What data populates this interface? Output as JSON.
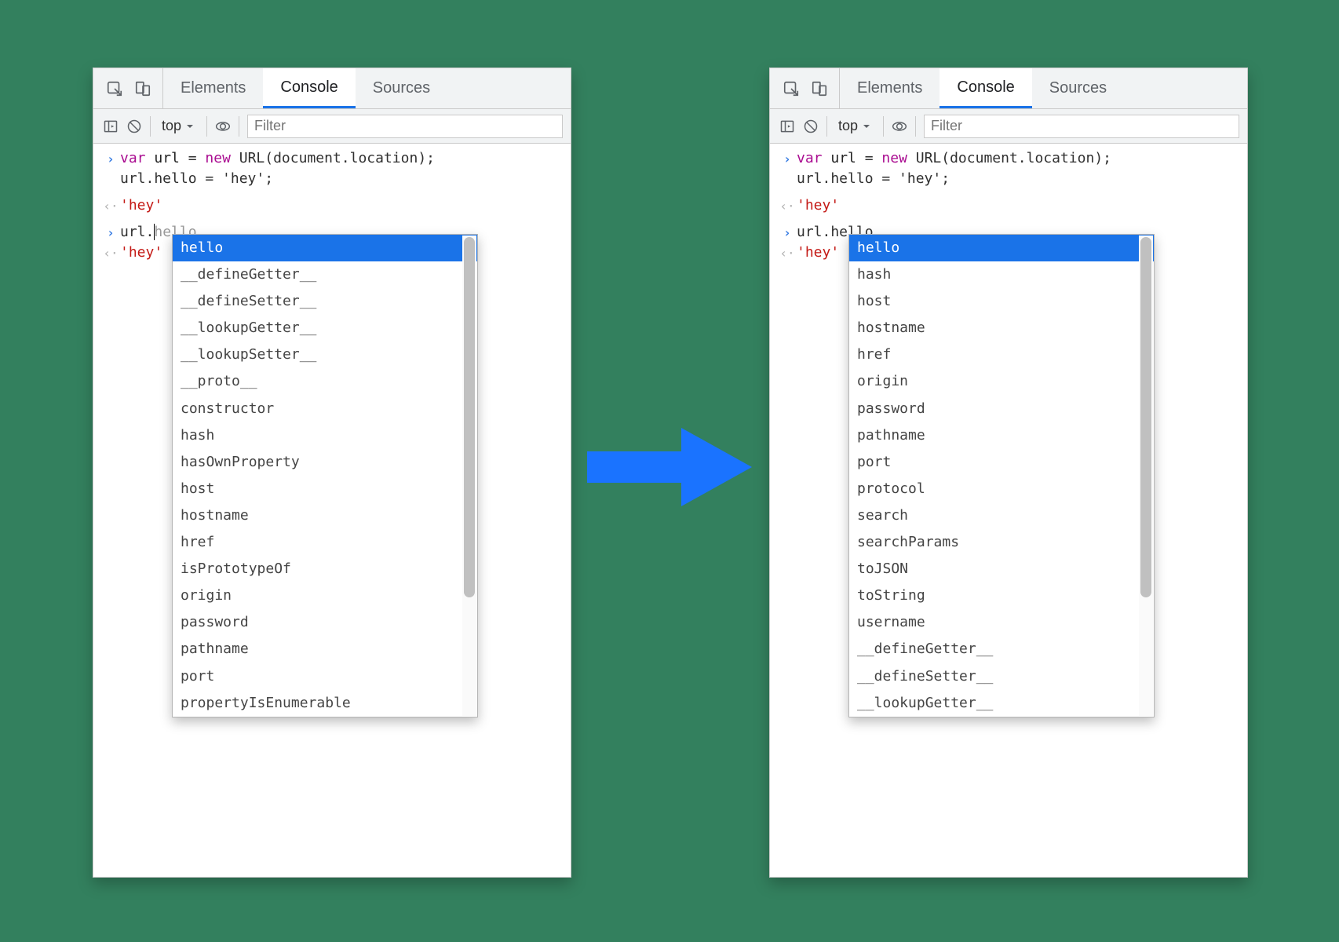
{
  "tabs": {
    "elements": "Elements",
    "console": "Console",
    "sources": "Sources"
  },
  "toolbar": {
    "context": "top",
    "filter_placeholder": "Filter"
  },
  "code": {
    "line1_var": "var",
    "line1_id": "url",
    "line1_eq": " = ",
    "line1_new": "new",
    "line1_call": " URL(document.location);",
    "line2": "url.hello = 'hey';",
    "out1": "'hey'",
    "input_left": "url.",
    "input_hint_left": "hello",
    "input_right": "url.hello",
    "out2": "'hey'"
  },
  "autocomplete_left": {
    "selected": "hello",
    "items": [
      "__defineGetter__",
      "__defineSetter__",
      "__lookupGetter__",
      "__lookupSetter__",
      "__proto__",
      "constructor",
      "hash",
      "hasOwnProperty",
      "host",
      "hostname",
      "href",
      "isPrototypeOf",
      "origin",
      "password",
      "pathname",
      "port",
      "propertyIsEnumerable"
    ]
  },
  "autocomplete_right": {
    "selected": "hello",
    "items": [
      "hash",
      "host",
      "hostname",
      "href",
      "origin",
      "password",
      "pathname",
      "port",
      "protocol",
      "search",
      "searchParams",
      "toJSON",
      "toString",
      "username",
      "__defineGetter__",
      "__defineSetter__",
      "__lookupGetter__"
    ]
  }
}
